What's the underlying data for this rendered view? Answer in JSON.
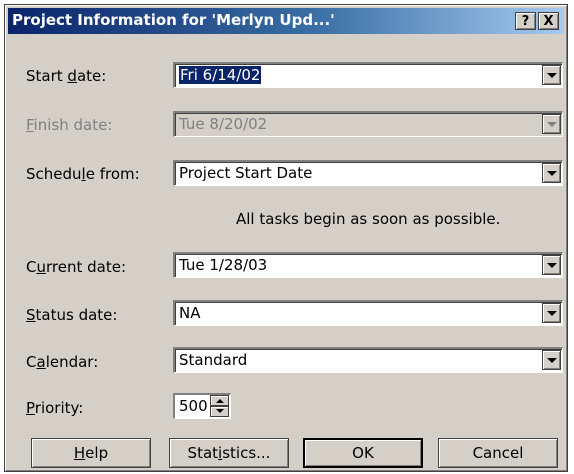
{
  "dialog": {
    "title": "Project Information for 'Merlyn Upd...'",
    "help_glyph": "?",
    "close_glyph": "X"
  },
  "fields": {
    "start_date": {
      "label_pre": "Start ",
      "label_key": "d",
      "label_post": "ate:",
      "value": "Fri 6/14/02"
    },
    "finish_date": {
      "label_pre": "",
      "label_key": "F",
      "label_post": "inish date:",
      "value": "Tue 8/20/02"
    },
    "schedule_from": {
      "label_pre": "Schedu",
      "label_key": "l",
      "label_post": "e from:",
      "value": "Project Start Date"
    },
    "schedule_info": "All tasks begin as soon as possible.",
    "current_date": {
      "label_pre": "C",
      "label_key": "u",
      "label_post": "rrent date:",
      "value": "Tue 1/28/03"
    },
    "status_date": {
      "label_pre": "",
      "label_key": "S",
      "label_post": "tatus date:",
      "value": "NA"
    },
    "calendar": {
      "label_pre": "C",
      "label_key": "a",
      "label_post": "lendar:",
      "value": "Standard"
    },
    "priority": {
      "label_pre": "",
      "label_key": "P",
      "label_post": "riority:",
      "value": "500"
    }
  },
  "buttons": {
    "help": {
      "pre": "",
      "key": "H",
      "post": "elp"
    },
    "statistics": {
      "pre": "Stat",
      "key": "i",
      "post": "stics..."
    },
    "ok": "OK",
    "cancel": "Cancel"
  },
  "icons": {
    "dropdown": "chevron-down-icon",
    "spin_up": "spin-up-icon",
    "spin_down": "spin-down-icon"
  },
  "colors": {
    "titlebar_start": "#0a246a",
    "titlebar_end": "#a6caf0",
    "dialog_bg": "#d4d0c8",
    "selection": "#0a246a",
    "disabled_text": "#808080"
  }
}
